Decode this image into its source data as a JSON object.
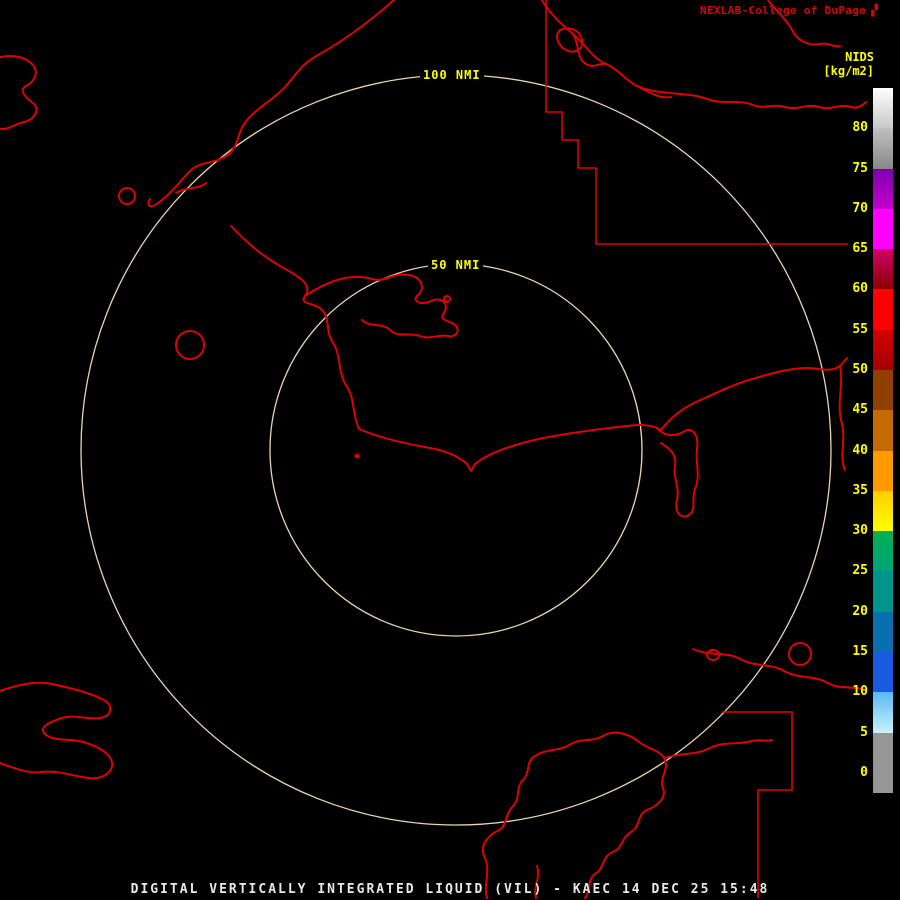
{
  "header": {
    "source": "NEXLAB-College of DuPage",
    "logo_glyph": "▞",
    "product": "NIDS",
    "units": "[kg/m2]"
  },
  "rings": {
    "outer_label": "100 NMI",
    "inner_label": "50 NMI"
  },
  "footer": {
    "title": "DIGITAL VERTICALLY INTEGRATED LIQUID (VIL) - KAEC 14 DEC 25 15:48"
  },
  "colors": {
    "background": "#000000",
    "map_outline": "#dd0202",
    "range_ring": "#e9d5ae",
    "label_yellow": "#ffff00",
    "footer_text": "#e8e8e8"
  },
  "colorbar": {
    "orientation": "vertical",
    "ticks": [
      80,
      75,
      70,
      65,
      60,
      55,
      50,
      45,
      40,
      35,
      30,
      25,
      20,
      15,
      10,
      5,
      0
    ],
    "segments": [
      {
        "range": "above-80",
        "color": "#ffffff",
        "color2": "#c8c8c8",
        "span": 1
      },
      {
        "range": "75-80",
        "color": "#c0c0c0",
        "color2": "#888888",
        "span": 1
      },
      {
        "range": "70-75",
        "color": "#7d00b0",
        "color2": "#c400cc",
        "span": 1
      },
      {
        "range": "65-70",
        "color": "#ff00ff",
        "span": 1
      },
      {
        "range": "60-65",
        "color": "#d4006a",
        "color2": "#8a0000",
        "span": 1
      },
      {
        "range": "55-60",
        "color": "#ff0000",
        "span": 1
      },
      {
        "range": "50-55",
        "color": "#d40000",
        "color2": "#a40000",
        "span": 1
      },
      {
        "range": "45-50",
        "color": "#8f3f00",
        "span": 1
      },
      {
        "range": "40-45",
        "color": "#c46a00",
        "span": 1
      },
      {
        "range": "35-40",
        "color": "#ff9900",
        "span": 1
      },
      {
        "range": "30-35",
        "color": "#ffcc00",
        "color2": "#ffff00",
        "span": 1
      },
      {
        "range": "25-30",
        "color": "#00b050",
        "color2": "#00a37a",
        "span": 1
      },
      {
        "range": "20-25",
        "color": "#00948c",
        "span": 1
      },
      {
        "range": "15-20",
        "color": "#0a6fae",
        "span": 1
      },
      {
        "range": "10-15",
        "color": "#1a5ae0",
        "span": 1
      },
      {
        "range": "5-10",
        "color": "#59b9f2",
        "color2": "#c9f2ff",
        "span": 1
      },
      {
        "range": "0-5",
        "color": "#969696",
        "span": 1.5
      }
    ]
  }
}
